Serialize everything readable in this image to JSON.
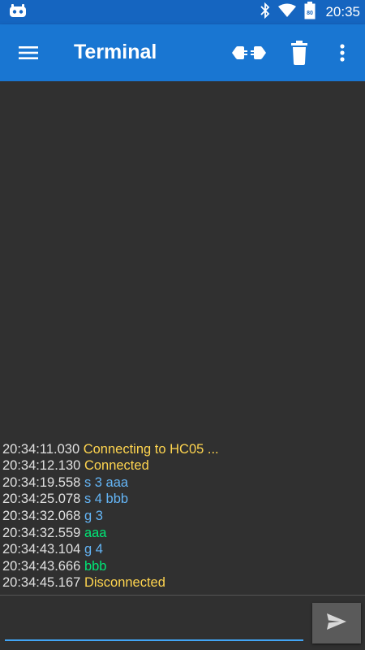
{
  "status_bar": {
    "time": "20:35",
    "battery_level": "80",
    "icons": [
      "app-notification-icon",
      "bluetooth-icon",
      "wifi-icon",
      "battery-icon"
    ]
  },
  "app_bar": {
    "title": "Terminal",
    "icons": [
      "menu-icon",
      "connect-icon",
      "delete-icon",
      "overflow-icon"
    ]
  },
  "terminal": {
    "lines": [
      {
        "time": "20:34:11.030",
        "text": "Connecting to HC05 ...",
        "type": "status"
      },
      {
        "time": "20:34:12.130",
        "text": "Connected",
        "type": "status"
      },
      {
        "time": "20:34:19.558",
        "text": "s 3 aaa",
        "type": "send"
      },
      {
        "time": "20:34:25.078",
        "text": "s 4 bbb",
        "type": "send"
      },
      {
        "time": "20:34:32.068",
        "text": "g 3",
        "type": "send"
      },
      {
        "time": "20:34:32.559",
        "text": "aaa",
        "type": "recv"
      },
      {
        "time": "20:34:43.104",
        "text": "g 4",
        "type": "send"
      },
      {
        "time": "20:34:43.666",
        "text": "bbb",
        "type": "recv"
      },
      {
        "time": "20:34:45.167",
        "text": "Disconnected",
        "type": "status"
      }
    ]
  },
  "input": {
    "value": "",
    "placeholder": ""
  },
  "colors": {
    "status_bar": "#1565c0",
    "app_bar": "#1976d2",
    "background": "#303030",
    "status_text": "#ffd54f",
    "send_text": "#64b5f6",
    "recv_text": "#00e676",
    "underline": "#42a5f5"
  }
}
